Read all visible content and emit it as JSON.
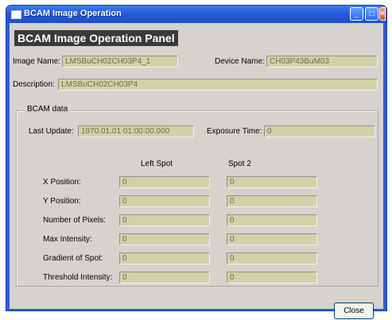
{
  "window": {
    "title": "BCAM Image Operation"
  },
  "panel": {
    "title": "BCAM Image Operation Panel"
  },
  "info": {
    "image_name_label": "Image Name:",
    "image_name_value": "LMSBuCH02CH03P4_1",
    "device_name_label": "Device Name:",
    "device_name_value": "CH03P43BuM03",
    "description_label": "Description:",
    "description_value": "LMSBuCH02CH03P4"
  },
  "bcam": {
    "group_title": "BCAM data",
    "last_update_label": "Last Update:",
    "last_update_value": "1970.01.01 01:00:00.000",
    "exposure_label": "Exposure Time:",
    "exposure_value": "0",
    "col_left": "Left Spot",
    "col_right": "Spot 2",
    "rows": [
      {
        "label": "X Position:",
        "left": "0",
        "right": "0"
      },
      {
        "label": "Y Position:",
        "left": "0",
        "right": "0"
      },
      {
        "label": "Number of Pixels:",
        "left": "0",
        "right": "0"
      },
      {
        "label": "Max Intensity:",
        "left": "0",
        "right": "0"
      },
      {
        "label": "Gradient of Spot:",
        "left": "0",
        "right": "0"
      },
      {
        "label": "Threshold Intensity:",
        "left": "0",
        "right": "0"
      }
    ]
  },
  "buttons": {
    "close_label": "Close"
  },
  "colors": {
    "field_bg": "#cfd3a8",
    "title_bar": "#2457d8",
    "client_bg": "#d6d3ce"
  }
}
